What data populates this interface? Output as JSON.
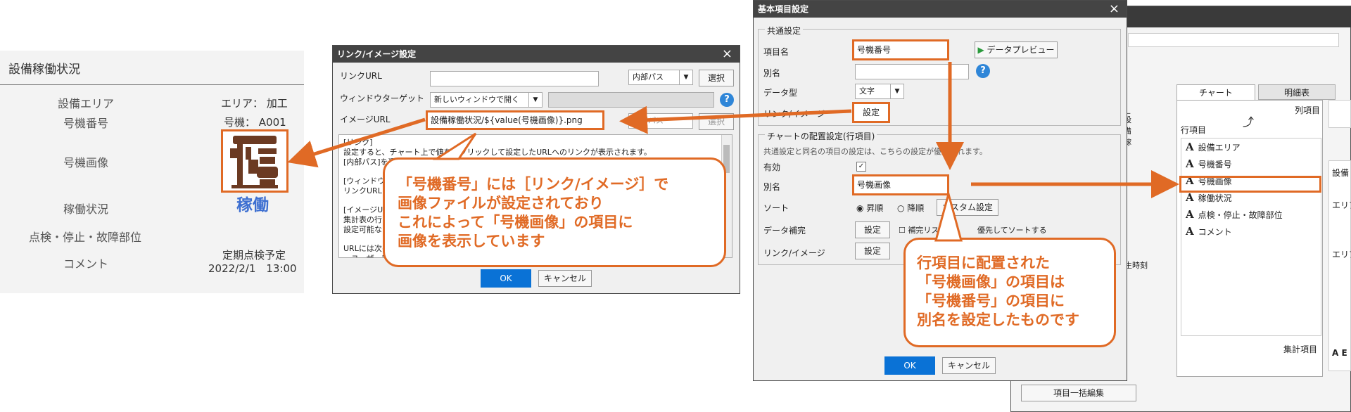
{
  "report": {
    "title": "設備稼働状況",
    "labels": {
      "area": "設備エリア",
      "machine_no": "号機番号",
      "machine_image": "号機画像",
      "operation": "稼働状況",
      "inspection": "点検・停止・故障部位",
      "comment": "コメント"
    },
    "values": {
      "area": "エリア： 加工",
      "machine_no": "号機： A001",
      "status": "稼働",
      "comment_line1": "定期点検予定",
      "comment_line2": "2022/2/1　13:00"
    }
  },
  "link_dialog": {
    "title": "リンク/イメージ設定",
    "close": "×",
    "link_url_label": "リンクURL",
    "path_type": "内部パス",
    "select_btn": "選択",
    "window_target_label": "ウィンドウターゲット",
    "window_target_value": "新しいウィンドウで開く",
    "image_url_label": "イメージURL",
    "image_url_value": "設備稼働状況/${value(号機画像)}.png",
    "path_type2": "内部パス",
    "select_btn2": "選択",
    "help_lines": [
      "[リンク]",
      "設定すると、チャート上で値を右クリックして設定したURLへのリンクが表示されます。",
      "[内部パス]を選",
      "",
      "[ウィンドウター",
      "リンクURLを",
      "",
      "[イメージUR",
      "集計表の行",
      "設定可能な",
      "",
      "URLには次の",
      "・ユーザー定義"
    ],
    "ok": "OK",
    "cancel": "キャンセル"
  },
  "basic_dialog": {
    "title": "基本項目設定",
    "close": "×",
    "common_group": "共通設定",
    "item_name_label": "項目名",
    "item_name_value": "号機番号",
    "data_preview_btn": "データプレビュー",
    "alias_label": "別名",
    "data_type_label": "データ型",
    "data_type_value": "文字",
    "link_image_label": "リンク/イメージ",
    "link_image_btn": "設定",
    "chart_group": "チャートの配置設定(行項目)",
    "chart_group_note": "共通設定と同名の項目の設定は、こちらの設定が優先されます。",
    "enabled_label": "有効",
    "alias2_label": "別名",
    "alias2_value": "号機画像",
    "sort_label": "ソート",
    "sort_asc": "昇順",
    "sort_desc": "降順",
    "custom_btn": "カスタム設定",
    "complement_label": "データ補完",
    "complement_btn": "設定",
    "complement_check": "補完リスト",
    "complement_note": "優先してソートする",
    "link_image2_label": "リンク/イメージ",
    "link_image2_btn": "設定",
    "ok": "OK",
    "cancel": "キャンセル"
  },
  "designer": {
    "tabs": [
      "チャート",
      "明細表"
    ],
    "col_label": "列項目",
    "row_label": "行項目",
    "rows": [
      {
        "icon": "A",
        "label": "設備エリア"
      },
      {
        "icon": "A",
        "label": "号機番号"
      },
      {
        "icon": "A",
        "label": "号機画像"
      },
      {
        "icon": "A",
        "label": "稼働状況"
      },
      {
        "icon": "A",
        "label": "点検・停止・故障部位"
      },
      {
        "icon": "A",
        "label": "コメント"
      }
    ],
    "agg_label": "集計項目",
    "left_header": "|_設備稼",
    "left_partial": "発生時刻",
    "bulk_edit_btn": "項目一括編集",
    "right_partial1": "設備",
    "right_partial2": "エリア",
    "right_partial3": "エリア",
    "right_partial4": "A E"
  },
  "callouts": {
    "left": [
      "「号機番号」には［リンク/イメージ］で",
      "画像ファイルが設定されており",
      "これによって「号機画像」の項目に",
      "画像を表示しています"
    ],
    "right": [
      "行項目に配置された",
      "「号機画像」の項目は",
      "「号機番号」の項目に",
      "別名を設定したものです"
    ]
  },
  "colors": {
    "accent": "#e06a25",
    "link_blue": "#3d6fd1",
    "ok_blue": "#0a72d6",
    "title_bar": "#444444"
  }
}
